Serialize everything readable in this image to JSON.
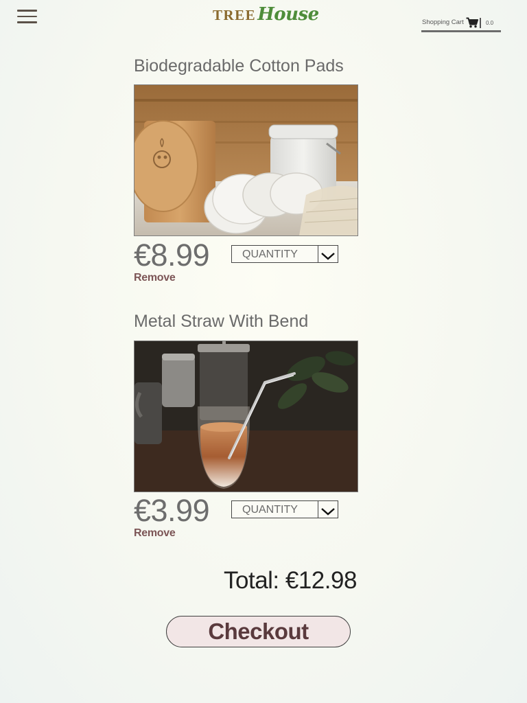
{
  "header": {
    "menu_icon": "hamburger-menu-icon",
    "logo": {
      "tree": "TREE",
      "house": "House"
    },
    "cart": {
      "label": "Shopping Cart",
      "icon": "shopping-cart-icon",
      "total": "0.0"
    }
  },
  "cart_items": [
    {
      "name": "Biodegradable Cotton Pads",
      "image": "cotton-pads-photo",
      "price": "€8.99",
      "quantity_label": "QUANTITY",
      "remove_label": "Remove"
    },
    {
      "name": "Metal Straw With Bend",
      "image": "metal-straw-photo",
      "price": "€3.99",
      "quantity_label": "QUANTITY",
      "remove_label": "Remove"
    }
  ],
  "summary": {
    "total": "Total: €12.98",
    "checkout_label": "Checkout"
  },
  "colors": {
    "logo_tree": "#8a6a2e",
    "logo_house": "#4e8d3a",
    "remove_link": "#7c5556",
    "checkout_bg": "#f2e6e6",
    "checkout_text": "#5a3a3d"
  }
}
